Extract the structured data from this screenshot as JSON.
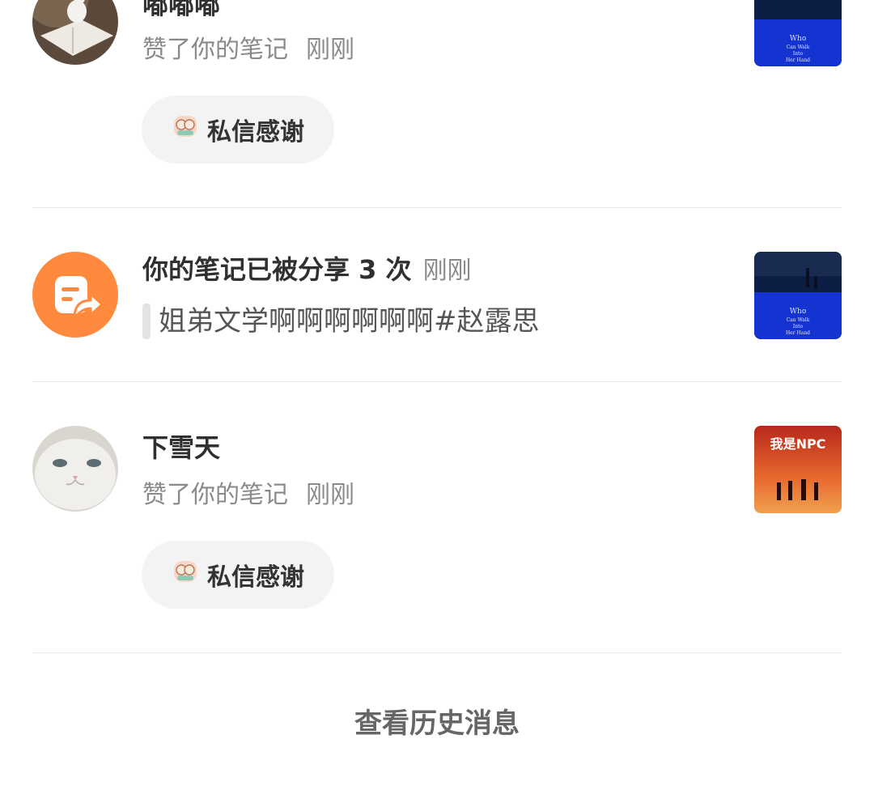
{
  "notifications": [
    {
      "user": "嘟嘟嘟",
      "action": "赞了你的笔记",
      "time": "刚刚",
      "button_label": "私信感谢",
      "thumb_text": [
        "Who",
        "Can Walk",
        "Into",
        "Her Hand"
      ]
    },
    {
      "title": "你的笔记已被分享 3 次",
      "time": "刚刚",
      "quote": "姐弟文学啊啊啊啊啊啊#赵露思",
      "thumb_text": [
        "Who",
        "Can Walk",
        "Into",
        "Her Hand"
      ]
    },
    {
      "user": "下雪天",
      "action": "赞了你的笔记",
      "time": "刚刚",
      "button_label": "私信感谢",
      "thumb_text": [
        "我是NPC"
      ]
    }
  ],
  "footer": {
    "history_label": "查看历史消息"
  },
  "colors": {
    "share_icon_bg": "#FF8A3D",
    "divider": "#E8E8E8",
    "button_bg": "#F3F3F3"
  }
}
